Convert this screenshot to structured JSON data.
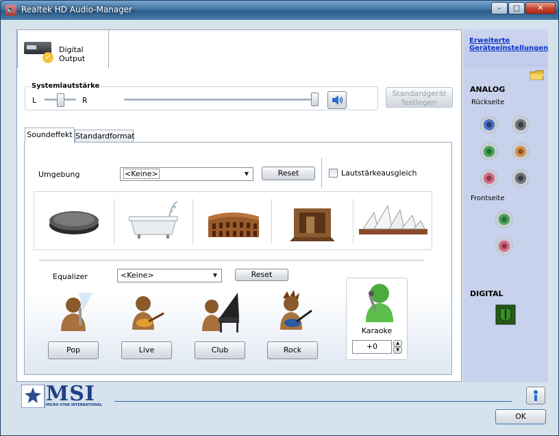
{
  "window": {
    "title": "Realtek HD Audio-Manager",
    "controls": {
      "minimize": "–",
      "maximize": "□",
      "close": "✕"
    }
  },
  "tabs": {
    "digital_output": "Digital Output"
  },
  "volume": {
    "title": "Systemlautstärke",
    "left": "L",
    "right": "R",
    "default_device_line1": "Standardgerät",
    "default_device_line2": "festlegen"
  },
  "subtabs": {
    "sound_effect": "Soundeffekt",
    "default_format": "Standardformat"
  },
  "environment": {
    "label": "Umgebung",
    "selected": "<Keine>",
    "reset": "Reset",
    "loudness": "Lautstärkeausgleich",
    "loudness_checked": false,
    "presets": [
      "stone-icon",
      "bathtub-icon",
      "colosseum-icon",
      "room-icon",
      "opera-house-icon"
    ]
  },
  "equalizer": {
    "label": "Equalizer",
    "selected": "<Keine>",
    "reset": "Reset",
    "presets": [
      "Pop",
      "Live",
      "Club",
      "Rock"
    ]
  },
  "karaoke": {
    "label": "Karaoke",
    "value": "+0"
  },
  "sidebar": {
    "link_line1": "Erweiterte",
    "link_line2": "Geräteeinstellungen",
    "analog": "ANALOG",
    "rear": "Rückseite",
    "front": "Frontseite",
    "digital": "DIGITAL",
    "rear_jack_colors": [
      "#4a72c8",
      "#6e7276",
      "#47a55a",
      "#d8904a",
      "#d46c84",
      "#6e7276"
    ],
    "front_jack_colors": [
      "#47a55a",
      "#d46c84"
    ]
  },
  "footer": {
    "brand": "MSI",
    "brand_sub": "MICRO-STAR INTERNATIONAL",
    "ok": "OK"
  }
}
